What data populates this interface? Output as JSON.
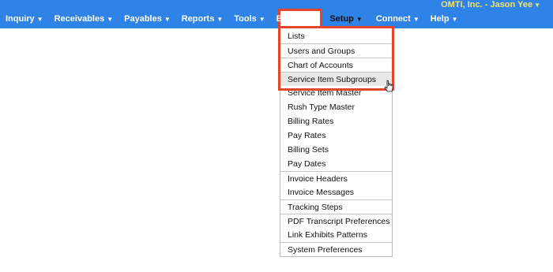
{
  "app": {
    "user_label": "OMTI, Inc. - Jason Yee",
    "caret": "▼"
  },
  "nav": {
    "items": [
      {
        "label": "Inquiry"
      },
      {
        "label": "Receivables"
      },
      {
        "label": "Payables"
      },
      {
        "label": "Reports"
      },
      {
        "label": "Tools"
      },
      {
        "label": "Entities"
      },
      {
        "label": "Setup"
      },
      {
        "label": "Connect"
      },
      {
        "label": "Help"
      }
    ]
  },
  "setup_menu": {
    "items": [
      {
        "label": "Lists"
      },
      {
        "label": "Users and Groups"
      },
      {
        "label": "Chart of Accounts"
      },
      {
        "label": "Service Item Subgroups"
      },
      {
        "label": "Service Item Master"
      },
      {
        "label": "Rush Type Master"
      },
      {
        "label": "Billing Rates"
      },
      {
        "label": "Pay Rates"
      },
      {
        "label": "Billing Sets"
      },
      {
        "label": "Pay Dates"
      },
      {
        "label": "Invoice Headers"
      },
      {
        "label": "Invoice Messages"
      },
      {
        "label": "Tracking Steps"
      },
      {
        "label": "PDF Transcript Preferences"
      },
      {
        "label": "Link Exhibits Patterns"
      },
      {
        "label": "System Preferences"
      }
    ]
  },
  "colors": {
    "navbar": "#2f82e6",
    "user_text": "#f2e36a",
    "highlight": "#e4462d"
  }
}
